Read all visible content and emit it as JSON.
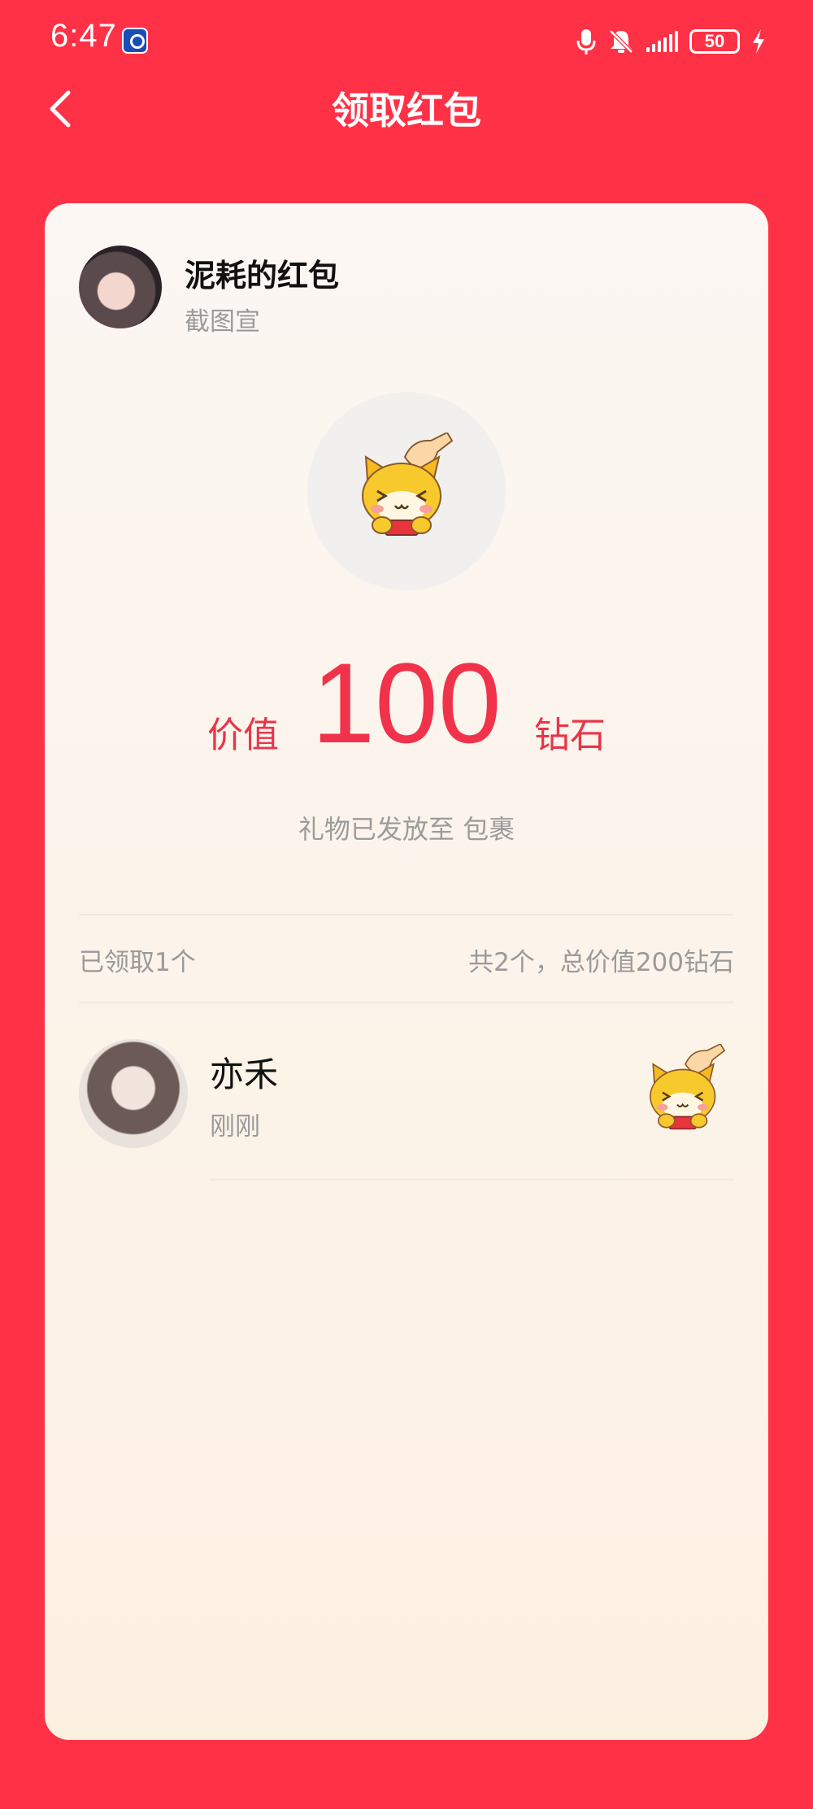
{
  "status_bar": {
    "time": "6:47",
    "battery": "50"
  },
  "header": {
    "title": "领取红包"
  },
  "card": {
    "sender_name": "泥耗的红包",
    "sender_subtitle": "截图宣",
    "value_prefix": "价值",
    "value_amount": "100",
    "value_unit": "钻石",
    "sent_note": "礼物已发放至 包裹",
    "claimed_count": "已领取1个",
    "total_summary": "共2个，总价值200钻石",
    "receivers": [
      {
        "name": "亦禾",
        "time": "刚刚"
      }
    ]
  },
  "colors": {
    "background": "#ff3146",
    "accent": "#f0334a",
    "card": "#fcf4ec"
  },
  "icons": [
    "back-arrow-icon",
    "microphone-icon",
    "bell-muted-icon",
    "signal-icon",
    "battery-icon",
    "charging-icon",
    "cat-gift-icon"
  ]
}
